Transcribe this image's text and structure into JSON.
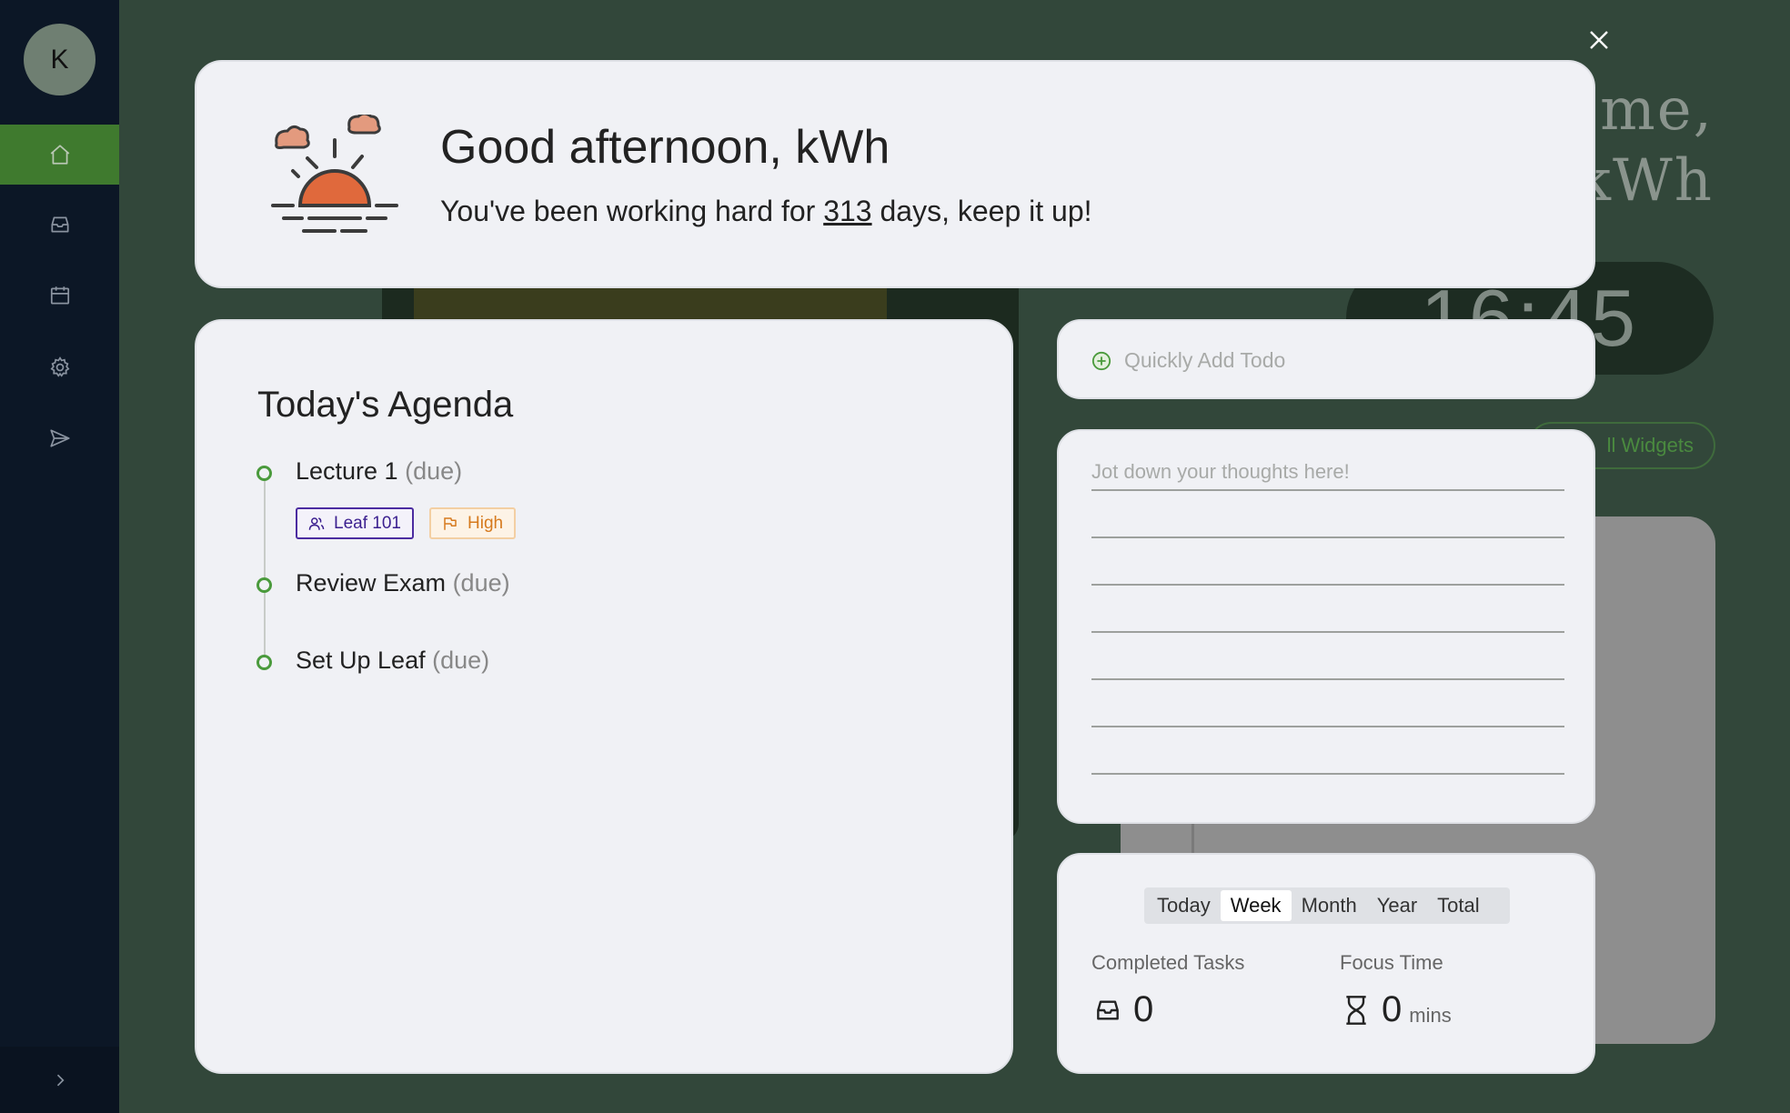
{
  "sidebar": {
    "avatar_initial": "K",
    "nav": [
      {
        "icon": "home-icon",
        "active": true
      },
      {
        "icon": "inbox-icon",
        "active": false
      },
      {
        "icon": "calendar-icon",
        "active": false
      },
      {
        "icon": "gear-icon",
        "active": false
      },
      {
        "icon": "send-icon",
        "active": false
      }
    ],
    "expand_icon": "chevron-right-icon"
  },
  "background": {
    "welcome_line1": "ome,",
    "welcome_line2": "kWh",
    "clock": "16:45",
    "widgets_button": "ll Widgets"
  },
  "greeting": {
    "title": "Good afternoon, kWh",
    "sub_prefix": "You've been working hard for ",
    "days": "313",
    "sub_suffix": " days, keep it up!"
  },
  "agenda": {
    "title": "Today's Agenda",
    "items": [
      {
        "name": "Lecture 1",
        "status": "(due)",
        "course_tag": "Leaf 101",
        "priority_tag": "High"
      },
      {
        "name": "Review Exam",
        "status": "(due)"
      },
      {
        "name": "Set Up Leaf",
        "status": "(due)"
      }
    ]
  },
  "quick_add": {
    "placeholder": "Quickly Add Todo"
  },
  "notes": {
    "placeholder": "Jot down your thoughts here!"
  },
  "stats": {
    "periods": [
      "Today",
      "Week",
      "Month",
      "Year",
      "Total"
    ],
    "selected": "Week",
    "completed_label": "Completed Tasks",
    "completed_value": "0",
    "focus_label": "Focus Time",
    "focus_value": "0",
    "focus_unit": "mins"
  },
  "colors": {
    "accent_green": "#4a9a3c",
    "sidebar_bg": "#0c1726",
    "page_bg": "#32473a",
    "sun_orange": "#e0693c"
  }
}
